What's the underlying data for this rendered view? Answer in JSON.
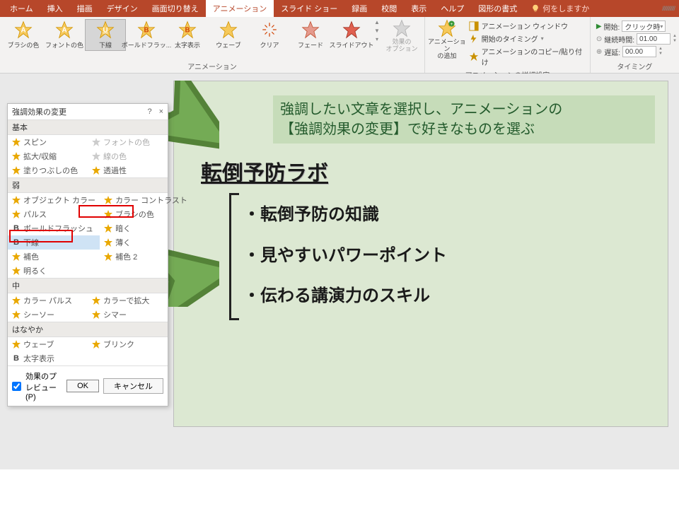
{
  "tabs": {
    "home": "ホーム",
    "insert": "挿入",
    "draw": "描画",
    "design": "デザイン",
    "transitions": "画面切り替え",
    "animations": "アニメーション",
    "slideshow": "スライド ショー",
    "record": "録画",
    "review": "校閲",
    "view": "表示",
    "help": "ヘルプ",
    "shapefmt": "図形の書式",
    "tellme": "何をしますか"
  },
  "ribbon": {
    "gallery": {
      "brush": "ブラシの色",
      "font": "フォントの色",
      "underline": "下線",
      "boldflash": "ボールドフラッ...",
      "bold": "太字表示",
      "wave": "ウェーブ",
      "clear": "クリア",
      "fade": "フェード",
      "slideout": "スライドアウト"
    },
    "effect_options": "効果の\nオプション",
    "group_anim": "アニメーション",
    "add_anim": "アニメーション\nの追加",
    "adv": {
      "pane": "アニメーション ウィンドウ",
      "trigger": "開始のタイミング",
      "painter": "アニメーションのコピー/貼り付け"
    },
    "group_adv": "アニメーションの詳細設定",
    "timing": {
      "start_lbl": "開始:",
      "start_val": "クリック時",
      "duration_lbl": "継続時間:",
      "duration_val": "01.00",
      "delay_lbl": "遅延:",
      "delay_val": "00.00"
    },
    "group_timing": "タイミング"
  },
  "dialog": {
    "title": "強調効果の変更",
    "sections": {
      "basic": "基本",
      "subtle": "弱",
      "moderate": "中",
      "exciting": "はなやか"
    },
    "items": {
      "spin": "スピン",
      "fontcolor": "フォントの色",
      "growshrink": "拡大/収縮",
      "linecolor": "線の色",
      "fill": "塗りつぶしの色",
      "transparency": "透過性",
      "objcolor": "オブジェクト カラー",
      "colorcontrast": "カラー コントラスト",
      "pulse": "パルス",
      "brushcolor": "ブラシの色",
      "boldflash": "ボールドフラッシュ",
      "darken": "暗く",
      "underline": "下線",
      "lighten": "薄く",
      "complement": "補色",
      "complement2": "補色 2",
      "brighten": "明るく",
      "colorpulse": "カラー パルス",
      "colorextend": "カラーで拡大",
      "teeter": "シーソー",
      "shimmer": "シマー",
      "wave": "ウェーブ",
      "blink": "ブリンク",
      "boldreveal": "太字表示"
    },
    "preview": "効果のプレビュー(P)",
    "ok": "OK",
    "cancel": "キャンセル"
  },
  "slide": {
    "callout_l1": "強調したい文章を選択し、アニメーションの",
    "callout_l2": "【強調効果の変更】で好きなものを選ぶ",
    "title": "転倒予防ラボ",
    "b1": "・転倒予防の知識",
    "b2": "・見やすいパワーポイント",
    "b3": "・伝わる講演力のスキル"
  }
}
